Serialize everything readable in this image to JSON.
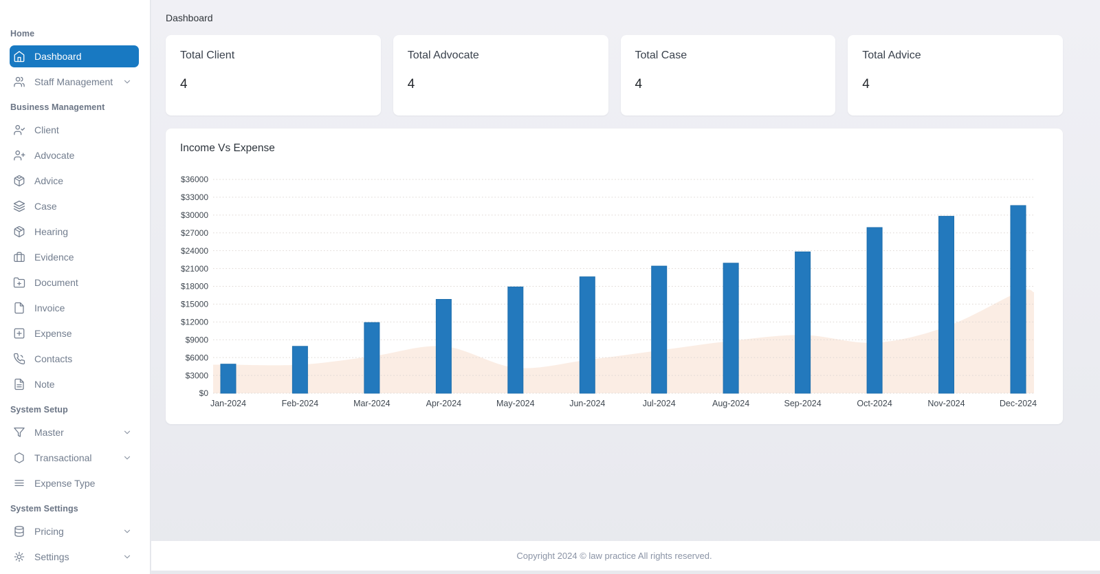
{
  "page": {
    "title": "Dashboard"
  },
  "colors": {
    "accent": "#1879c2",
    "sidebar_text": "#727d8e",
    "bar_fill": "#2379bd",
    "bar_stroke": "#1f6fad",
    "area_fill": "#fbede4",
    "grid_line": "#ded7d3",
    "axis_label": "#3f4750",
    "card_bg": "#ffffff",
    "main_bg": "#ebecf1"
  },
  "sidebar": {
    "sections": [
      {
        "header": "Home",
        "items": [
          {
            "label": "Dashboard",
            "icon": "home",
            "active": true,
            "chevron": false
          },
          {
            "label": "Staff Management",
            "icon": "users",
            "active": false,
            "chevron": true
          }
        ]
      },
      {
        "header": "Business Management",
        "items": [
          {
            "label": "Client",
            "icon": "user-check",
            "active": false,
            "chevron": false
          },
          {
            "label": "Advocate",
            "icon": "user-plus",
            "active": false,
            "chevron": false
          },
          {
            "label": "Advice",
            "icon": "codesandbox",
            "active": false,
            "chevron": false
          },
          {
            "label": "Case",
            "icon": "layers",
            "active": false,
            "chevron": false
          },
          {
            "label": "Hearing",
            "icon": "package",
            "active": false,
            "chevron": false
          },
          {
            "label": "Evidence",
            "icon": "briefcase",
            "active": false,
            "chevron": false
          },
          {
            "label": "Document",
            "icon": "folder-plus",
            "active": false,
            "chevron": false
          },
          {
            "label": "Invoice",
            "icon": "file",
            "active": false,
            "chevron": false
          },
          {
            "label": "Expense",
            "icon": "plus-square",
            "active": false,
            "chevron": false
          },
          {
            "label": "Contacts",
            "icon": "phone-call",
            "active": false,
            "chevron": false
          },
          {
            "label": "Note",
            "icon": "file-text",
            "active": false,
            "chevron": false
          }
        ]
      },
      {
        "header": "System Setup",
        "items": [
          {
            "label": "Master",
            "icon": "filter",
            "active": false,
            "chevron": true
          },
          {
            "label": "Transactional",
            "icon": "hexagon",
            "active": false,
            "chevron": true
          },
          {
            "label": "Expense Type",
            "icon": "list",
            "active": false,
            "chevron": false
          }
        ]
      },
      {
        "header": "System Settings",
        "items": [
          {
            "label": "Pricing",
            "icon": "database",
            "active": false,
            "chevron": true
          },
          {
            "label": "Settings",
            "icon": "gear",
            "active": false,
            "chevron": true
          }
        ]
      }
    ]
  },
  "cards": [
    {
      "title": "Total Client",
      "value": "4"
    },
    {
      "title": "Total Advocate",
      "value": "4"
    },
    {
      "title": "Total Case",
      "value": "4"
    },
    {
      "title": "Total Advice",
      "value": "4"
    }
  ],
  "chart_data": {
    "type": "bar",
    "title": "Income Vs Expense",
    "categories": [
      "Jan-2024",
      "Feb-2024",
      "Mar-2024",
      "Apr-2024",
      "May-2024",
      "Jun-2024",
      "Jul-2024",
      "Aug-2024",
      "Sep-2024",
      "Oct-2024",
      "Nov-2024",
      "Dec-2024"
    ],
    "series": [
      {
        "name": "Income",
        "type": "bar",
        "color": "#2379bd",
        "values": [
          4900,
          7900,
          11900,
          15800,
          17900,
          19600,
          21400,
          21900,
          23800,
          27900,
          29800,
          31600
        ]
      },
      {
        "name": "Expense",
        "type": "area",
        "color": "#fbede4",
        "values": [
          4800,
          4800,
          6200,
          7900,
          4300,
          5600,
          7200,
          8800,
          9800,
          8500,
          11200,
          17000
        ]
      }
    ],
    "ylabel_prefix": "$",
    "ylim": [
      0,
      36000
    ],
    "ytick_step": 3000,
    "grid": "dotted-horizontal",
    "legend": "none"
  },
  "footer": {
    "copyright": "Copyright 2024 © law practice All rights reserved."
  }
}
